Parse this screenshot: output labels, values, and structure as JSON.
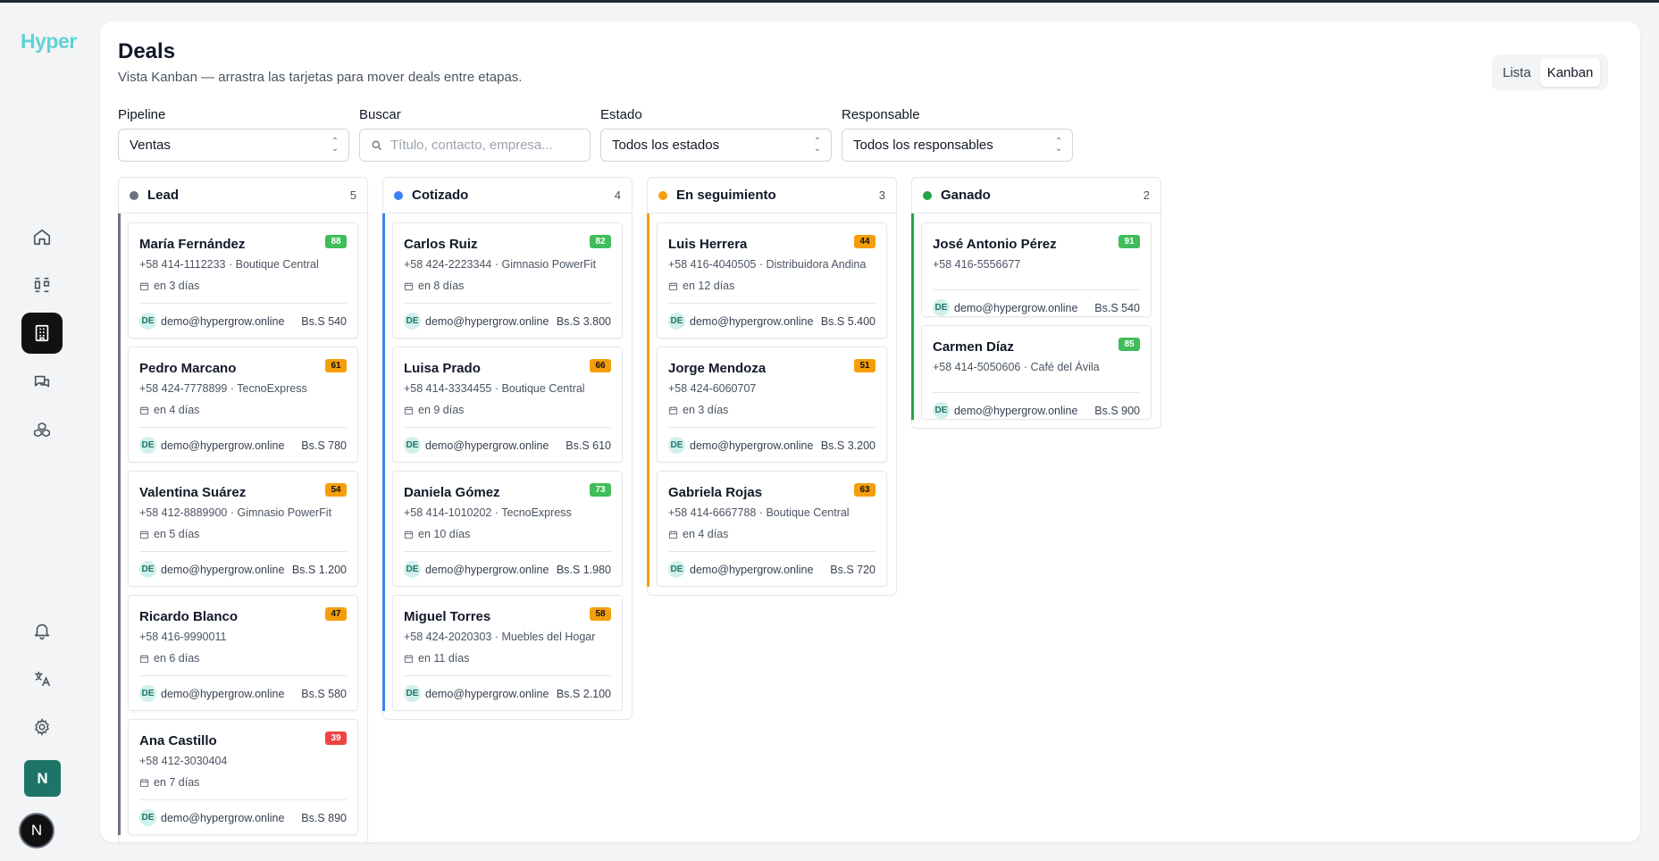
{
  "app": {
    "logo": "Hyper",
    "user_initial": "N",
    "profile_initial": "N"
  },
  "header": {
    "title": "Deals",
    "subtitle": "Vista Kanban — arrastra las tarjetas para mover deals entre etapas.",
    "view_list": "Lista",
    "view_kanban": "Kanban",
    "active_view": "Kanban"
  },
  "filters": {
    "pipeline": {
      "label": "Pipeline",
      "value": "Ventas"
    },
    "search": {
      "label": "Buscar",
      "placeholder": "Título, contacto, empresa..."
    },
    "status": {
      "label": "Estado",
      "value": "Todos los estados"
    },
    "owner": {
      "label": "Responsable",
      "value": "Todos los responsables"
    }
  },
  "sidebar": {
    "items": [
      {
        "icon": "home-icon"
      },
      {
        "icon": "kanban-icon"
      },
      {
        "icon": "building-icon",
        "active": true
      },
      {
        "icon": "chat-icon"
      },
      {
        "icon": "cubes-icon"
      }
    ],
    "bottom": [
      {
        "icon": "bell-icon"
      },
      {
        "icon": "translate-icon"
      },
      {
        "icon": "gear-icon"
      }
    ]
  },
  "colors": {
    "lead": "#6b7280",
    "cotizado": "#3b82f6",
    "seguimiento": "#f59e0b",
    "ganado": "#22a447",
    "accent": "#5fd3d6"
  },
  "columns": [
    {
      "title": "Lead",
      "count": "5",
      "color": "#6b7280",
      "cards": [
        {
          "name": "María Fernández",
          "score": "88",
          "level": "green",
          "info": "+58 414-1112233 · Boutique Central",
          "date": "en 3 días",
          "owner": "DE",
          "email": "demo@hypergrow.online",
          "amount": "Bs.S 540"
        },
        {
          "name": "Pedro Marcano",
          "score": "61",
          "level": "orange",
          "info": "+58 424-7778899 · TecnoExpress",
          "date": "en 4 días",
          "owner": "DE",
          "email": "demo@hypergrow.online",
          "amount": "Bs.S 780"
        },
        {
          "name": "Valentina Suárez",
          "score": "54",
          "level": "orange",
          "info": "+58 412-8889900 · Gimnasio PowerFit",
          "date": "en 5 días",
          "owner": "DE",
          "email": "demo@hypergrow.online",
          "amount": "Bs.S 1.200"
        },
        {
          "name": "Ricardo Blanco",
          "score": "47",
          "level": "orange",
          "info": "+58 416-9990011",
          "date": "en 6 días",
          "owner": "DE",
          "email": "demo@hypergrow.online",
          "amount": "Bs.S 580"
        },
        {
          "name": "Ana Castillo",
          "score": "39",
          "level": "red",
          "info": "+58 412-3030404",
          "date": "en 7 días",
          "owner": "DE",
          "email": "demo@hypergrow.online",
          "amount": "Bs.S 890"
        }
      ]
    },
    {
      "title": "Cotizado",
      "count": "4",
      "color": "#3b82f6",
      "cards": [
        {
          "name": "Carlos Ruiz",
          "score": "82",
          "level": "green",
          "info": "+58 424-2223344 · Gimnasio PowerFit",
          "date": "en 8 días",
          "owner": "DE",
          "email": "demo@hypergrow.online",
          "amount": "Bs.S 3.800"
        },
        {
          "name": "Luisa Prado",
          "score": "66",
          "level": "orange",
          "info": "+58 414-3334455 · Boutique Central",
          "date": "en 9 días",
          "owner": "DE",
          "email": "demo@hypergrow.online",
          "amount": "Bs.S 610"
        },
        {
          "name": "Daniela Gómez",
          "score": "73",
          "level": "green",
          "info": "+58 414-1010202 · TecnoExpress",
          "date": "en 10 días",
          "owner": "DE",
          "email": "demo@hypergrow.online",
          "amount": "Bs.S 1.980"
        },
        {
          "name": "Miguel Torres",
          "score": "58",
          "level": "orange",
          "info": "+58 424-2020303 · Muebles del Hogar",
          "date": "en 11 días",
          "owner": "DE",
          "email": "demo@hypergrow.online",
          "amount": "Bs.S 2.100"
        }
      ]
    },
    {
      "title": "En seguimiento",
      "count": "3",
      "color": "#f59e0b",
      "cards": [
        {
          "name": "Luis Herrera",
          "score": "44",
          "level": "orange",
          "info": "+58 416-4040505 · Distribuidora Andina",
          "date": "en 12 días",
          "owner": "DE",
          "email": "demo@hypergrow.online",
          "amount": "Bs.S 5.400"
        },
        {
          "name": "Jorge Mendoza",
          "score": "51",
          "level": "orange",
          "info": "+58 424-6060707",
          "date": "en 3 días",
          "owner": "DE",
          "email": "demo@hypergrow.online",
          "amount": "Bs.S 3.200"
        },
        {
          "name": "Gabriela Rojas",
          "score": "63",
          "level": "orange",
          "info": "+58 414-6667788 · Boutique Central",
          "date": "en 4 días",
          "owner": "DE",
          "email": "demo@hypergrow.online",
          "amount": "Bs.S 720"
        }
      ]
    },
    {
      "title": "Ganado",
      "count": "2",
      "color": "#22a447",
      "cards": [
        {
          "name": "José Antonio Pérez",
          "score": "91",
          "level": "green",
          "info": "+58 416-5556677",
          "date": "",
          "owner": "DE",
          "email": "demo@hypergrow.online",
          "amount": "Bs.S 540"
        },
        {
          "name": "Carmen Díaz",
          "score": "85",
          "level": "green",
          "info": "+58 414-5050606 · Café del Ávila",
          "date": "",
          "owner": "DE",
          "email": "demo@hypergrow.online",
          "amount": "Bs.S 900"
        }
      ]
    }
  ]
}
